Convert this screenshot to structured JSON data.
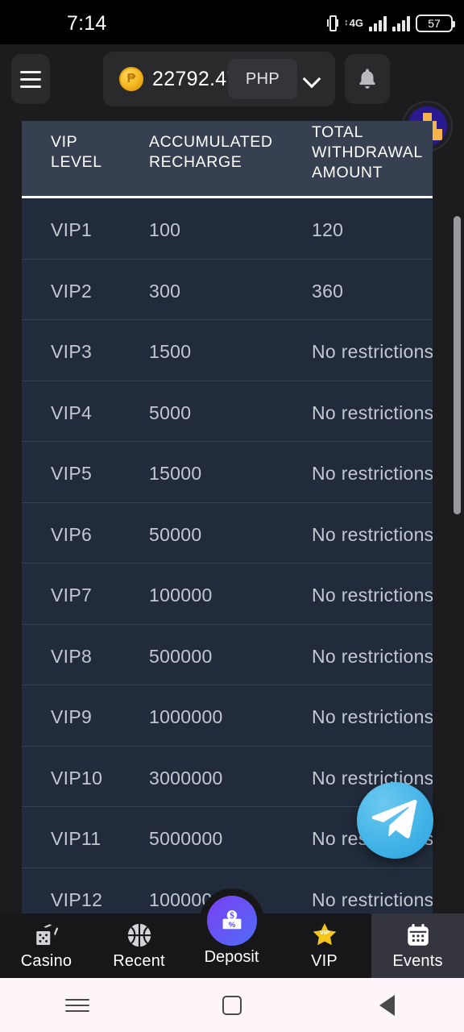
{
  "status_bar": {
    "time": "7:14",
    "vibrate_icon": "vibrate-icon",
    "network_type": "4G",
    "battery_percent": "57"
  },
  "header": {
    "menu_icon": "hamburger-menu-icon",
    "coin_icon": "peso-coin-icon",
    "balance": "22792.47",
    "currency": "PHP",
    "dropdown_icon": "chevron-down-icon",
    "bell_icon": "notification-bell-icon",
    "avatar_icon": "user-avatar"
  },
  "table": {
    "columns": [
      "VIP LEVEL",
      "ACCUMULATED RECHARGE",
      "TOTAL WITHDRAWAL AMOUNT"
    ],
    "header_line1": [
      "VIP",
      "ACCUMULATED",
      "TOTAL"
    ],
    "header_line2": [
      "LEVEL",
      "RECHARGE",
      "WITHDRAWAL"
    ],
    "header_line3": [
      "",
      "",
      "AMOUNT"
    ],
    "rows": [
      {
        "level": "VIP1",
        "recharge": "100",
        "withdrawal": "120"
      },
      {
        "level": "VIP2",
        "recharge": "300",
        "withdrawal": "360"
      },
      {
        "level": "VIP3",
        "recharge": "1500",
        "withdrawal": "No restrictions"
      },
      {
        "level": "VIP4",
        "recharge": "5000",
        "withdrawal": "No restrictions"
      },
      {
        "level": "VIP5",
        "recharge": "15000",
        "withdrawal": "No restrictions"
      },
      {
        "level": "VIP6",
        "recharge": "50000",
        "withdrawal": "No restrictions"
      },
      {
        "level": "VIP7",
        "recharge": "100000",
        "withdrawal": "No restrictions"
      },
      {
        "level": "VIP8",
        "recharge": "500000",
        "withdrawal": "No restrictions"
      },
      {
        "level": "VIP9",
        "recharge": "1000000",
        "withdrawal": "No restrictions"
      },
      {
        "level": "VIP10",
        "recharge": "3000000",
        "withdrawal": "No restrictions"
      },
      {
        "level": "VIP11",
        "recharge": "5000000",
        "withdrawal": "No restrictions"
      },
      {
        "level": "VIP12",
        "recharge": "100000",
        "withdrawal": "No restrictions"
      }
    ]
  },
  "floating_action": {
    "telegram_icon": "telegram-icon"
  },
  "bottom_nav": {
    "items": [
      {
        "label": "Casino",
        "icon": "dice-icon",
        "active": false
      },
      {
        "label": "Recent",
        "icon": "basketball-icon",
        "active": false
      },
      {
        "label": "Deposit",
        "icon": "deposit-icon",
        "active": false
      },
      {
        "label": "VIP",
        "icon": "vip-star-icon",
        "active": false
      },
      {
        "label": "Events",
        "icon": "calendar-icon",
        "active": true
      }
    ],
    "vip_star_text": "VIP"
  },
  "android_nav": {
    "recent_icon": "recent-apps-icon",
    "home_icon": "home-icon",
    "back_icon": "back-icon"
  },
  "colors": {
    "status_bar_bg": "#000000",
    "app_bg": "#1c1c1e",
    "table_header_bg": "#364050",
    "table_row_bg": "#212b3b",
    "row_divider": "#33404f",
    "text_primary": "#ffffff",
    "text_cell": "#c2c8d2",
    "telegram_blue": "#44b4e8",
    "deposit_gradient_start": "#7b3ff2",
    "deposit_gradient_end": "#4f6df5",
    "vip_gold": "#f5c518",
    "coin_gold": "#f5b921",
    "nav_active_bg": "#35353f",
    "android_nav_bg": "#fdf5f9"
  }
}
